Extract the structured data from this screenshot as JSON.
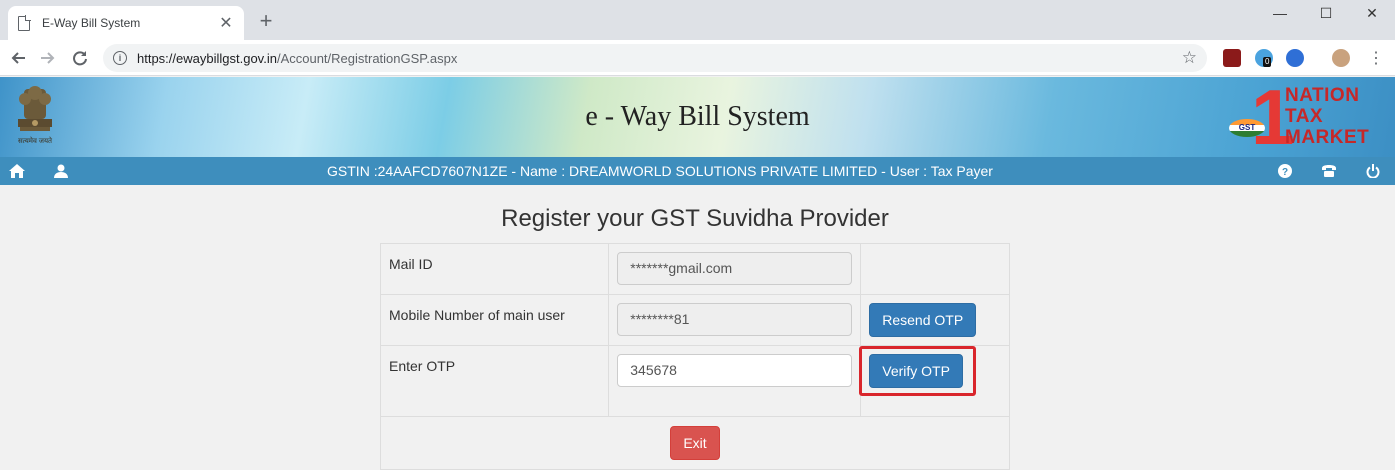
{
  "browser": {
    "tab_title": "E-Way Bill System",
    "tab_close": "✕",
    "new_tab": "+",
    "window_controls": {
      "minimize": "—",
      "maximize": "☐",
      "close": "✕"
    },
    "url_host": "https://ewaybillgst.gov.in",
    "url_path": "/Account/RegistrationGSP.aspx",
    "extension_badge": "0"
  },
  "header": {
    "site_title": "e - Way Bill System",
    "emblem_caption": "सत्यमेव जयते",
    "logo_number": "1",
    "logo_lines": [
      "NATION",
      "TAX",
      "MARKET"
    ],
    "logo_badge": "GST"
  },
  "userbar": {
    "info": "GSTIN :24AAFCD7607N1ZE - Name : DREAMWORLD SOLUTIONS PRIVATE LIMITED - User : Tax Payer"
  },
  "page": {
    "heading": "Register your GST Suvidha Provider",
    "rows": [
      {
        "label": "Mail ID",
        "value": "*******gmail.com"
      },
      {
        "label": "Mobile Number of main user",
        "value": "********81",
        "button": "Resend OTP"
      },
      {
        "label": "Enter OTP",
        "value": "345678",
        "button": "Verify OTP"
      }
    ],
    "exit_button": "Exit"
  },
  "colors": {
    "userbar": "#3e8ebd",
    "primary_button": "#337ab7",
    "danger_button": "#d9534f",
    "highlight": "#d9262c"
  }
}
